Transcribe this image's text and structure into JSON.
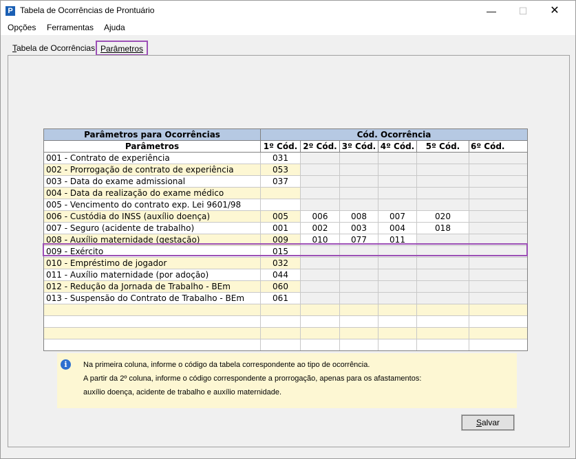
{
  "window": {
    "title": "Tabela de Ocorrências de Prontuário",
    "minimize_glyph": "—",
    "maximize_glyph": "☐",
    "close_glyph": "✕"
  },
  "menu": {
    "items": [
      "Opções",
      "Ferramentas",
      "Ajuda"
    ]
  },
  "tabs": [
    {
      "accel": "T",
      "rest": "abela de Ocorrências",
      "active": false
    },
    {
      "accel": "P",
      "rest": "arâmetros",
      "active": true
    }
  ],
  "grid": {
    "group_headers": [
      "Parâmetros para Ocorrências",
      "Cód. Ocorrência"
    ],
    "columns": [
      "Parâmetros",
      "1º Cód.",
      "2º Cód.",
      "3º Cód.",
      "4º Cód.",
      "5º Cód.",
      "6º Cód."
    ],
    "rows": [
      {
        "desc": "001 - Contrato de experiência",
        "codes": [
          "031",
          "",
          "",
          "",
          "",
          ""
        ]
      },
      {
        "desc": "002 - Prorrogação de contrato de experiência",
        "codes": [
          "053",
          "",
          "",
          "",
          "",
          ""
        ]
      },
      {
        "desc": "003 - Data do exame admissional",
        "codes": [
          "037",
          "",
          "",
          "",
          "",
          ""
        ]
      },
      {
        "desc": "004 - Data da realização do exame médico",
        "codes": [
          "",
          "",
          "",
          "",
          "",
          ""
        ]
      },
      {
        "desc": "005 - Vencimento do contrato exp. Lei 9601/98",
        "codes": [
          "",
          "",
          "",
          "",
          "",
          ""
        ]
      },
      {
        "desc": "006 - Custódia do INSS (auxílio doença)",
        "codes": [
          "005",
          "006",
          "008",
          "007",
          "020",
          ""
        ]
      },
      {
        "desc": "007 - Seguro (acidente de trabalho)",
        "codes": [
          "001",
          "002",
          "003",
          "004",
          "018",
          ""
        ]
      },
      {
        "desc": "008 - Auxílio maternidade (gestação)",
        "codes": [
          "009",
          "010",
          "077",
          "011",
          "",
          ""
        ]
      },
      {
        "desc": "009 - Exército",
        "codes": [
          "015",
          "",
          "",
          "",
          "",
          ""
        ]
      },
      {
        "desc": "010 - Empréstimo de jogador",
        "codes": [
          "032",
          "",
          "",
          "",
          "",
          ""
        ]
      },
      {
        "desc": "011 - Auxílio maternidade (por adoção)",
        "codes": [
          "044",
          "",
          "",
          "",
          "",
          ""
        ]
      },
      {
        "desc": "012 - Redução da Jornada de Trabalho - BEm",
        "codes": [
          "060",
          "",
          "",
          "",
          "",
          ""
        ]
      },
      {
        "desc": "013 - Suspensão do Contrato de Trabalho - BEm",
        "codes": [
          "061",
          "",
          "",
          "",
          "",
          ""
        ]
      },
      {
        "desc": "",
        "codes": [
          "",
          "",
          "",
          "",
          "",
          ""
        ]
      },
      {
        "desc": "",
        "codes": [
          "",
          "",
          "",
          "",
          "",
          ""
        ]
      },
      {
        "desc": "",
        "codes": [
          "",
          "",
          "",
          "",
          "",
          ""
        ]
      },
      {
        "desc": "",
        "codes": [
          "",
          "",
          "",
          "",
          "",
          ""
        ]
      }
    ],
    "selected_row": 8
  },
  "info": {
    "icon": "info-icon",
    "lines": [
      "Na primeira coluna, informe o código da tabela correspondente ao tipo de ocorrência.",
      "A partir da 2º coluna, informe o código correspondente a prorrogação, apenas para os afastamentos:",
      "auxílio doença, acidente de trabalho e auxílio maternidade."
    ]
  },
  "buttons": {
    "save_accel": "S",
    "save_rest": "alvar"
  },
  "colors": {
    "header_blue": "#b6c9e3",
    "row_yellow": "#fdf7d3",
    "highlight": "#9b4fb5"
  }
}
